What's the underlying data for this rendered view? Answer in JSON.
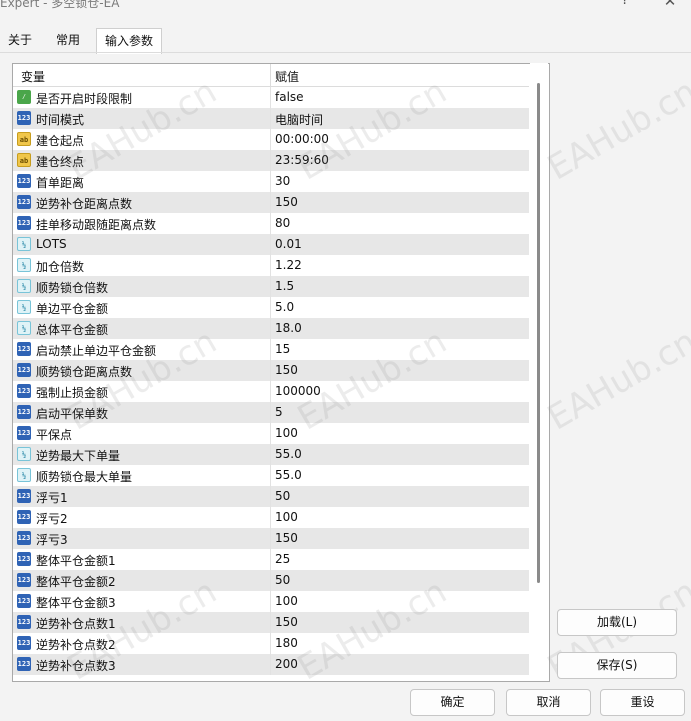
{
  "window": {
    "title": "Expert - 多空锁仓-EA",
    "help_glyph": "?",
    "close_glyph": "✕"
  },
  "tabs": [
    {
      "label": "关于",
      "active": false
    },
    {
      "label": "常用",
      "active": false
    },
    {
      "label": "输入参数",
      "active": true
    }
  ],
  "grid": {
    "headers": {
      "variable": "变量",
      "value": "赋值"
    },
    "rows": [
      {
        "name": "是否开启时段限制",
        "value": "false",
        "type": "bool"
      },
      {
        "name": "时间模式",
        "value": "电脑时间",
        "type": "int"
      },
      {
        "name": "建仓起点",
        "value": "00:00:00",
        "type": "string"
      },
      {
        "name": "建仓终点",
        "value": "23:59:60",
        "type": "string"
      },
      {
        "name": "首单距离",
        "value": "30",
        "type": "int"
      },
      {
        "name": "逆势补仓距离点数",
        "value": "150",
        "type": "int"
      },
      {
        "name": "挂单移动跟随距离点数",
        "value": "80",
        "type": "int"
      },
      {
        "name": "LOTS",
        "value": "0.01",
        "type": "double"
      },
      {
        "name": "加仓倍数",
        "value": "1.22",
        "type": "double"
      },
      {
        "name": "顺势锁仓倍数",
        "value": "1.5",
        "type": "double"
      },
      {
        "name": "单边平仓金额",
        "value": "5.0",
        "type": "double"
      },
      {
        "name": "总体平仓金额",
        "value": "18.0",
        "type": "double"
      },
      {
        "name": "启动禁止单边平仓金额",
        "value": "15",
        "type": "int"
      },
      {
        "name": "顺势锁仓距离点数",
        "value": "150",
        "type": "int"
      },
      {
        "name": "强制止损金额",
        "value": "100000",
        "type": "int"
      },
      {
        "name": "启动平保单数",
        "value": "5",
        "type": "int"
      },
      {
        "name": "平保点",
        "value": "100",
        "type": "int"
      },
      {
        "name": "逆势最大下单量",
        "value": "55.0",
        "type": "double"
      },
      {
        "name": "顺势锁仓最大单量",
        "value": "55.0",
        "type": "double"
      },
      {
        "name": "浮亏1",
        "value": "50",
        "type": "int"
      },
      {
        "name": "浮亏2",
        "value": "100",
        "type": "int"
      },
      {
        "name": "浮亏3",
        "value": "150",
        "type": "int"
      },
      {
        "name": "整体平仓金额1",
        "value": "25",
        "type": "int"
      },
      {
        "name": "整体平仓金额2",
        "value": "50",
        "type": "int"
      },
      {
        "name": "整体平仓金额3",
        "value": "100",
        "type": "int"
      },
      {
        "name": "逆势补仓点数1",
        "value": "150",
        "type": "int"
      },
      {
        "name": "逆势补仓点数2",
        "value": "180",
        "type": "int"
      },
      {
        "name": "逆势补仓点数3",
        "value": "200",
        "type": "int"
      }
    ]
  },
  "icon_glyphs": {
    "int": "123",
    "double": "½",
    "string": "ab",
    "bool": "⁄"
  },
  "buttons": {
    "load": "加载(L)",
    "save": "保存(S)",
    "ok": "确定",
    "cancel": "取消",
    "reset": "重设"
  },
  "watermark": "EAHub.cn"
}
